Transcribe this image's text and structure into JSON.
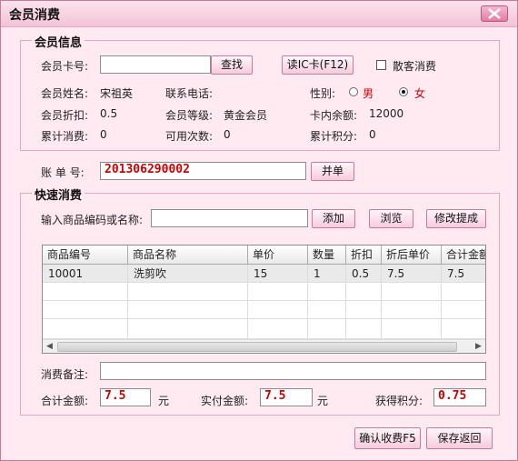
{
  "window": {
    "title": "会员消费"
  },
  "member_info": {
    "group_title": "会员信息",
    "card_no_label": "会员卡号:",
    "card_no_value": "",
    "find_button": "查找",
    "read_card_button": "读IC卡(F12)",
    "walkin_label": "散客消费",
    "name_label": "会员姓名:",
    "name_value": "宋祖英",
    "phone_label": "联系电话:",
    "phone_value": "",
    "gender_label": "性别:",
    "gender_male": "男",
    "gender_female": "女",
    "gender_selected": "女",
    "discount_label": "会员折扣:",
    "discount_value": "0.5",
    "level_label": "会员等级:",
    "level_value": "黄金会员",
    "balance_label": "卡内余额:",
    "balance_value": "12000",
    "total_spent_label": "累计消费:",
    "total_spent_value": "0",
    "times_label": "可用次数:",
    "times_value": "0",
    "points_label": "累计积分:",
    "points_value": "0"
  },
  "bill": {
    "label": "账 单 号:",
    "value": "201306290002",
    "merge_button": "并单"
  },
  "quick": {
    "group_title": "快速消费",
    "search_label": "输入商品编码或名称:",
    "search_value": "",
    "add_button": "添加",
    "browse_button": "浏览",
    "edit_commission_button": "修改提成",
    "columns": [
      "商品编号",
      "商品名称",
      "单价",
      "数量",
      "折扣",
      "折后单价",
      "合计金额"
    ],
    "rows": [
      [
        "10001",
        "洗剪吹",
        "15",
        "1",
        "0.5",
        "7.5",
        "7.5"
      ]
    ],
    "remark_label": "消费备注:",
    "remark_value": "",
    "total_label": "合计金额:",
    "total_value": "7.5",
    "total_unit": "元",
    "paid_label": "实付金额:",
    "paid_value": "7.5",
    "paid_unit": "元",
    "earned_label": "获得积分:",
    "earned_value": "0.75"
  },
  "footer": {
    "confirm_button": "确认收费F5",
    "save_button": "保存返回"
  }
}
